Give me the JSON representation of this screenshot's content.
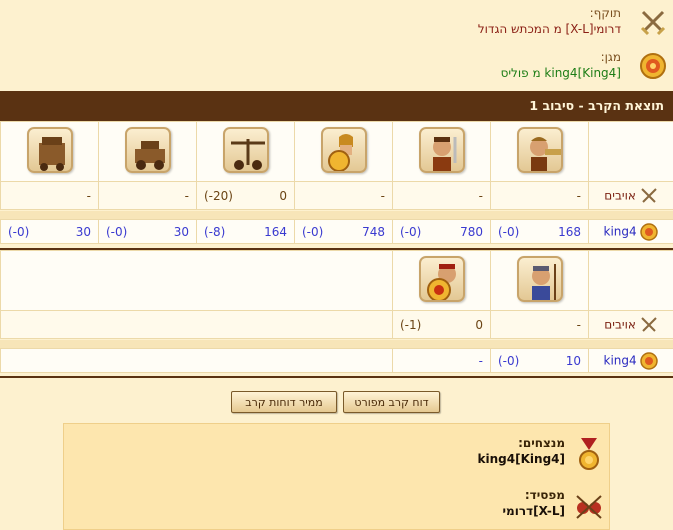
{
  "attacker": {
    "label": "תוקף:",
    "value": "דרומי[X-L] מ המכתש הגדול",
    "icon": "crossed-swords-icon"
  },
  "defender": {
    "label": "מגן:",
    "value": "king4[King4] מ פוליס",
    "icon": "shield-icon"
  },
  "battle_title": "תוצאת הקרב - סיבוב 1",
  "round1": {
    "units": [
      "archer-bronze-horn",
      "swordsman",
      "hoplite",
      "ballista",
      "catapult",
      "siege-tower"
    ],
    "enemy_label": "אויבים",
    "enemy_counts": [
      {
        "n": "-",
        "l": ""
      },
      {
        "n": "-",
        "l": ""
      },
      {
        "n": "-",
        "l": ""
      },
      {
        "n": "0",
        "l": "(-20)"
      },
      {
        "n": "-",
        "l": ""
      },
      {
        "n": "-",
        "l": ""
      }
    ],
    "defender_label": "king4",
    "defender_counts": [
      {
        "n": "168",
        "l": "(-0)"
      },
      {
        "n": "780",
        "l": "(-0)"
      },
      {
        "n": "748",
        "l": "(-0)"
      },
      {
        "n": "164",
        "l": "(-8)"
      },
      {
        "n": "30",
        "l": "(-0)"
      },
      {
        "n": "30",
        "l": "(-0)"
      }
    ]
  },
  "round2": {
    "units": [
      "spearman",
      "shield-slinger"
    ],
    "enemy_label": "אויבים",
    "enemy_counts": [
      {
        "n": "-",
        "l": ""
      },
      {
        "n": "0",
        "l": "(-1)"
      }
    ],
    "defender_label": "king4",
    "defender_counts": [
      {
        "n": "10",
        "l": "(-0)"
      },
      {
        "n": "-",
        "l": ""
      }
    ]
  },
  "buttons": {
    "detailed_report": "דוח קרב מפורט",
    "convert_reports": "ממיר דוחות קרב"
  },
  "result": {
    "winners_label": "מנצחים:",
    "winners_value": "[king4[King4",
    "loser_label": "מפסיד:",
    "loser_value": "[X-L]דרומי"
  },
  "colors": {
    "title_bar": "#5a3212",
    "background": "#fdf1cf",
    "attacker_text": "#8a1e14",
    "defender_text": "#1d7d16",
    "count_blue": "#3a3ad0"
  }
}
